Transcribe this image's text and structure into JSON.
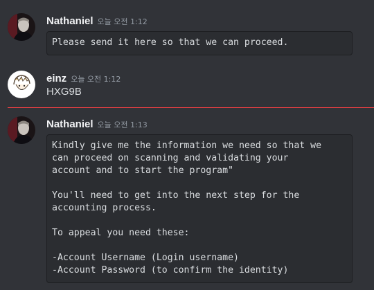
{
  "messages": [
    {
      "author": "Nathaniel",
      "time": "오늘 오전 1:12",
      "code": "Please send it here so that we can proceed."
    },
    {
      "author": "einz",
      "time": "오늘 오전 1:12",
      "text": "HXG9B"
    },
    {
      "author": "Nathaniel",
      "time": "오늘 오전 1:13",
      "code": "Kindly give me the information we need so that we\ncan proceed on scanning and validating your\naccount and to start the program\"\n\nYou'll need to get into the next step for the\naccounting process.\n\nTo appeal you need these:\n\n-Account Username (Login username)\n-Account Password (to confirm the identity)"
    }
  ],
  "colors": {
    "background": "#313338",
    "codeblock": "#2b2d31",
    "new_message_divider": "#f23f43"
  },
  "icons": {
    "nathaniel_avatar": "user-avatar-photo",
    "einz_avatar": "user-avatar-drawing"
  }
}
